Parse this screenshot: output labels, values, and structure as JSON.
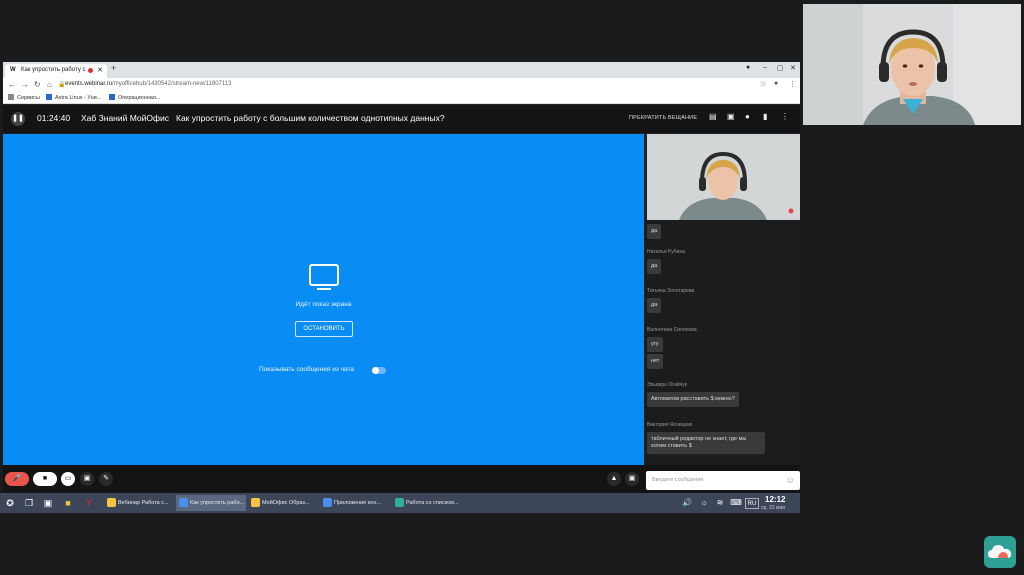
{
  "browser": {
    "tab_title": "Как упростить работу с",
    "tab_favicon": "W",
    "url_host": "events.webinar.ru",
    "url_path": "/myofficehub/1430542/stream-new/11807113",
    "bookmarks": [
      "Сервисы",
      "Astra Linux - Уни...",
      "Операционная..."
    ]
  },
  "webinar": {
    "timer": "01:24:40",
    "hub": "Хаб Знаний МойОфис",
    "title": "Как упростить работу с большим количеством однотипных данных?",
    "stop_broadcast": "ПРЕКРАТИТЬ ВЕЩАНИЕ",
    "screen_share_text": "Идёт показ экрана",
    "stop_button": "ОСТАНОВИТЬ",
    "show_chat_text": "Показывать сообщения из чата",
    "show_chat_on": false
  },
  "chat": {
    "messages": [
      {
        "author": "",
        "text": "да"
      },
      {
        "author": "Наталья Рубина",
        "text": "да"
      },
      {
        "author": "Татьяна Золотарева",
        "text": "да"
      },
      {
        "author": "Валентина Силонова",
        "text": "угу"
      },
      {
        "author": "",
        "text": "нет"
      },
      {
        "author": "Эльвира Огийчук",
        "text": "Автоматом расставить $ можно?"
      },
      {
        "author": "Виктория Ясницкая",
        "text": "табличный редактор не знает, где мы хотим ставить $"
      }
    ],
    "input_placeholder": "Введите сообщение"
  },
  "taskbar": {
    "windows": [
      {
        "label": "Вебинар Работа с...",
        "color": "#f5c542"
      },
      {
        "label": "Как упростить рабо...",
        "color": "#4a8ef0",
        "active": true
      },
      {
        "label": "МойОфис Образ...",
        "color": "#f5c542"
      },
      {
        "label": "Приложение кон...",
        "color": "#4a8ef0"
      },
      {
        "label": "Работа со списком...",
        "color": "#2fb0a0"
      }
    ],
    "lang": "RU",
    "time": "12:12",
    "date": "ср, 22 мая"
  }
}
